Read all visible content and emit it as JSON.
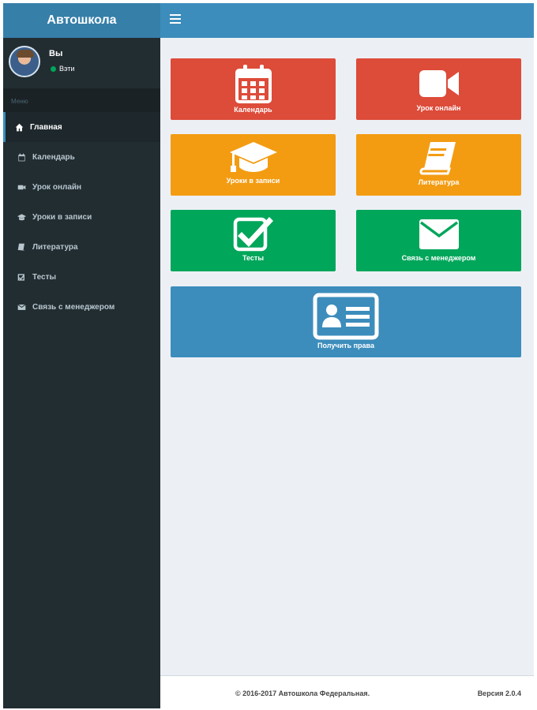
{
  "header": {
    "logo": "Автошкола"
  },
  "user": {
    "name": "Вы",
    "status": "Вэти"
  },
  "sidebar": {
    "menu_header": "Меню",
    "items": [
      {
        "label": "Главная",
        "icon": "home-icon"
      },
      {
        "label": "Календарь",
        "icon": "calendar-icon"
      },
      {
        "label": "Урок онлайн",
        "icon": "video-icon"
      },
      {
        "label": "Уроки в записи",
        "icon": "graduation-cap-icon"
      },
      {
        "label": "Литература",
        "icon": "book-icon"
      },
      {
        "label": "Тесты",
        "icon": "check-square-icon"
      },
      {
        "label": "Связь с менеджером",
        "icon": "envelope-icon"
      }
    ]
  },
  "tiles": [
    {
      "label": "Календарь",
      "icon": "calendar-icon",
      "color": "#dd4b39"
    },
    {
      "label": "Урок онлайн",
      "icon": "video-icon",
      "color": "#dd4b39"
    },
    {
      "label": "Уроки в записи",
      "icon": "graduation-cap-icon",
      "color": "#f39c12"
    },
    {
      "label": "Литература",
      "icon": "book-icon",
      "color": "#f39c12"
    },
    {
      "label": "Тесты",
      "icon": "check-square-icon",
      "color": "#00a65a"
    },
    {
      "label": "Связь с менеджером",
      "icon": "envelope-icon",
      "color": "#00a65a"
    },
    {
      "label": "Получить права",
      "icon": "id-card-icon",
      "color": "#3c8dbc"
    }
  ],
  "footer": {
    "copyright": "© 2016-2017 Автошкола Федеральная.",
    "version": "Версия 2.0.4"
  }
}
